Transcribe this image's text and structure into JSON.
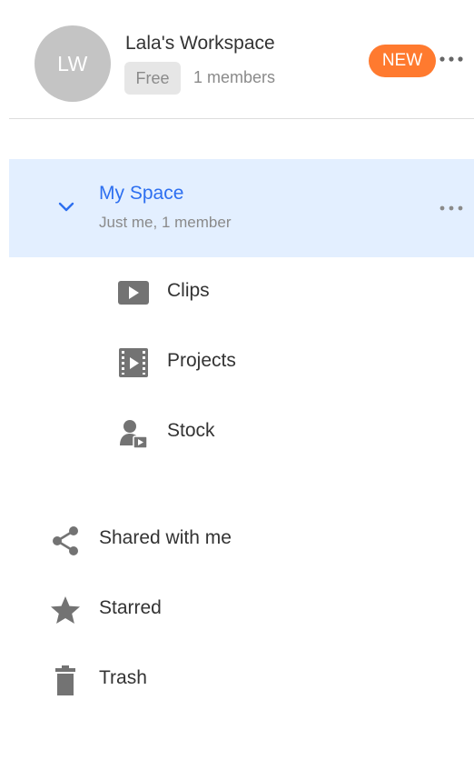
{
  "workspace": {
    "avatar_initials": "LW",
    "name": "Lala's Workspace",
    "plan": "Free",
    "members": "1 members",
    "new_badge": "NEW",
    "more_icon": "more-horizontal-icon"
  },
  "my_space": {
    "title": "My Space",
    "subtitle": "Just me, 1 member",
    "expanded": true,
    "icon": "chevron-down-icon"
  },
  "sub_items": [
    {
      "label": "Clips",
      "icon": "play-square-icon"
    },
    {
      "label": "Projects",
      "icon": "film-icon"
    },
    {
      "label": "Stock",
      "icon": "user-media-icon"
    }
  ],
  "nav_items": [
    {
      "label": "Shared with me",
      "icon": "share-icon"
    },
    {
      "label": "Starred",
      "icon": "star-icon"
    },
    {
      "label": "Trash",
      "icon": "trash-icon"
    }
  ],
  "colors": {
    "accent": "#2d6ff0",
    "selected_bg": "#e3efff",
    "new_badge": "#ff7a2f",
    "icon_gray": "#737373",
    "avatar_bg": "#c4c4c4"
  }
}
